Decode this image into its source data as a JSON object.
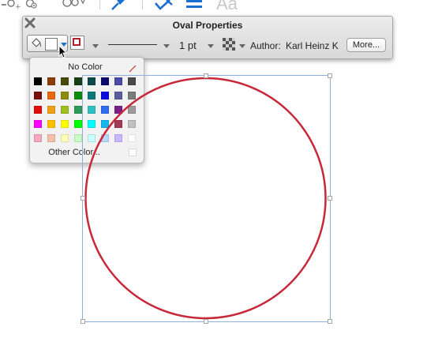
{
  "top_toolbar": {
    "icons": [
      "add-person-icon",
      "group-icon",
      "pin-icon",
      "stamp-icon",
      "lines-icon"
    ],
    "text_style_label": "Aa"
  },
  "panel": {
    "title": "Oval Properties",
    "close_icon": "close-icon",
    "fill_color": "#ffffff",
    "stroke_color": "#b3202d",
    "line_width": "1 pt",
    "author_label": "Author:",
    "author_value": "Karl Heinz K",
    "more_label": "More..."
  },
  "color_popup": {
    "no_color_label": "No Color",
    "other_color_label": "Other Color...",
    "swatches": [
      [
        "#000000",
        "#8b3d06",
        "#4a4a08",
        "#174017",
        "#0b4a4a",
        "#0b0b6e",
        "#4a4aa8",
        "#4a4a4a"
      ],
      [
        "#7a0b0b",
        "#e86810",
        "#8c8c10",
        "#0c8c0c",
        "#0c7a7a",
        "#0a0adf",
        "#5c5ca0",
        "#7a7a7a"
      ],
      [
        "#e80b0b",
        "#f0a018",
        "#a0c020",
        "#2e9a5a",
        "#2ec0c0",
        "#2f6df0",
        "#7a1f8a",
        "#9c9c9c"
      ],
      [
        "#ff00ff",
        "#ffc000",
        "#ffff00",
        "#00ff00",
        "#00ffff",
        "#17b8f0",
        "#a23a54",
        "#c0c0c0"
      ],
      [
        "#f7a8c0",
        "#f8c0a8",
        "#ffffb8",
        "#c8ffc8",
        "#c8ffff",
        "#b8d8ff",
        "#c8b8ff",
        "#ffffff"
      ]
    ]
  },
  "canvas": {
    "shape": "oval",
    "stroke_color": "#c7283a",
    "selection_color": "#8fb0d8"
  }
}
